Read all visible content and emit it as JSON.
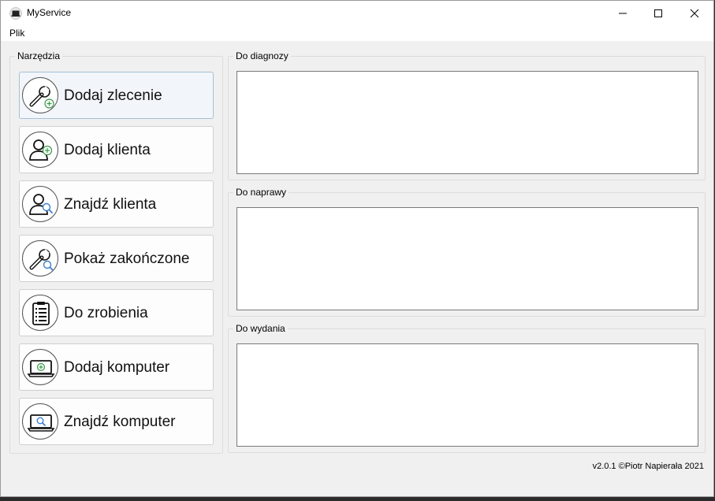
{
  "window": {
    "title": "MyService",
    "minimize_icon": "minimize-icon",
    "maximize_icon": "maximize-icon",
    "close_icon": "close-icon"
  },
  "menu": {
    "items": [
      {
        "label": "Plik"
      }
    ]
  },
  "tools": {
    "title": "Narzędzia",
    "buttons": [
      {
        "label": "Dodaj zlecenie",
        "icon": "wrench-add-icon"
      },
      {
        "label": "Dodaj klienta",
        "icon": "user-add-icon"
      },
      {
        "label": "Znajdź klienta",
        "icon": "user-search-icon"
      },
      {
        "label": "Pokaż zakończone",
        "icon": "wrench-search-icon"
      },
      {
        "label": "Do zrobienia",
        "icon": "clipboard-list-icon"
      },
      {
        "label": "Dodaj komputer",
        "icon": "laptop-add-icon"
      },
      {
        "label": "Znajdź komputer",
        "icon": "laptop-search-icon"
      }
    ]
  },
  "lists": [
    {
      "title": "Do diagnozy"
    },
    {
      "title": "Do naprawy"
    },
    {
      "title": "Do wydania"
    }
  ],
  "footer": {
    "text": "v2.0.1 ©Piotr Napierała 2021"
  },
  "colors": {
    "add_accent": "#3a9a4a",
    "search_accent": "#3a7fd0",
    "active_button_border": "#a7bfd6"
  }
}
